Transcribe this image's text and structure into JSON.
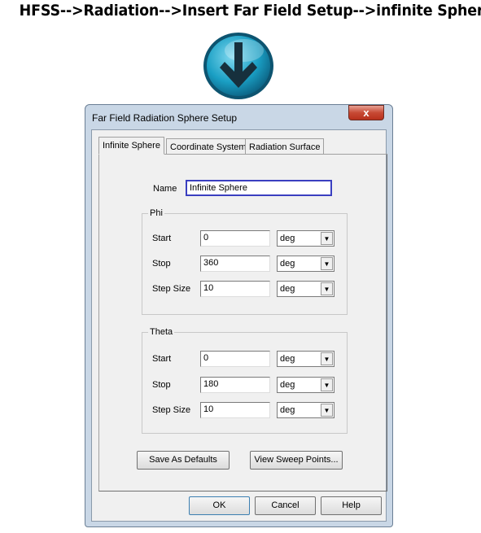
{
  "heading": "HFSS-->Radiation-->Insert Far Field Setup-->infinite Sphere",
  "dialog": {
    "title": "Far Field Radiation Sphere Setup",
    "close_label": "x",
    "tabs": [
      {
        "label": "Infinite Sphere",
        "active": true
      },
      {
        "label": "Coordinate System"
      },
      {
        "label": "Radiation Surface"
      }
    ],
    "name_label": "Name",
    "name_value": "Infinite Sphere",
    "phi": {
      "caption": "Phi",
      "rows": [
        {
          "label": "Start",
          "value": "0",
          "unit": "deg"
        },
        {
          "label": "Stop",
          "value": "360",
          "unit": "deg"
        },
        {
          "label": "Step Size",
          "value": "10",
          "unit": "deg"
        }
      ]
    },
    "theta": {
      "caption": "Theta",
      "rows": [
        {
          "label": "Start",
          "value": "0",
          "unit": "deg"
        },
        {
          "label": "Stop",
          "value": "180",
          "unit": "deg"
        },
        {
          "label": "Step Size",
          "value": "10",
          "unit": "deg"
        }
      ]
    },
    "save_defaults": "Save As Defaults",
    "view_sweep": "View Sweep Points...",
    "ok": "OK",
    "cancel": "Cancel",
    "help": "Help"
  },
  "colors": {
    "name_focus_border": "#3a3fc0",
    "arrow_button": "#1a9fc4"
  }
}
